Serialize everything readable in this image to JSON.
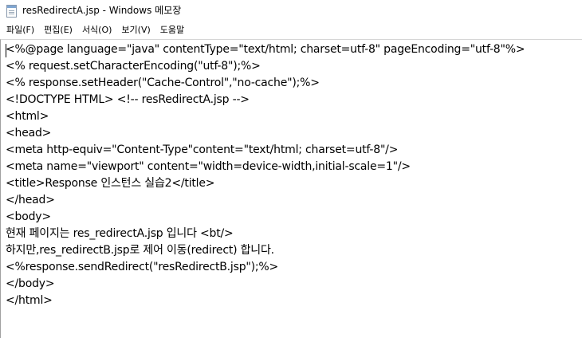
{
  "window": {
    "title": "resRedirectA.jsp - Windows 메모장"
  },
  "menu": {
    "items": [
      {
        "label": "파일(F)"
      },
      {
        "label": "편집(E)"
      },
      {
        "label": "서식(O)"
      },
      {
        "label": "보기(V)"
      },
      {
        "label": "도움말"
      }
    ]
  },
  "editor": {
    "lines": [
      "<%@page language=\"java\" contentType=\"text/html; charset=utf-8\" pageEncoding=\"utf-8\"%>",
      "<% request.setCharacterEncoding(\"utf-8\");%>",
      "<% response.setHeader(\"Cache-Control\",\"no-cache\");%>",
      "<!DOCTYPE HTML> <!-- resRedirectA.jsp -->",
      "<html>",
      "<head>",
      "<meta http-equiv=\"Content-Type\"content=\"text/html; charset=utf-8\"/>",
      "<meta name=\"viewport\" content=\"width=device-width,initial-scale=1\"/>",
      "<title>Response 인스턴스 실습2</title>",
      "</head>",
      "<body>",
      "현재 페이지는 res_redirectA.jsp 입니다 <bt/>",
      "하지만,res_redirectB.jsp로 제어 이동(redirect) 합니다.",
      "<%response.sendRedirect(\"resRedirectB.jsp\");%>",
      "</body>",
      "</html>"
    ]
  },
  "icons": {
    "title": "notepad-icon"
  }
}
